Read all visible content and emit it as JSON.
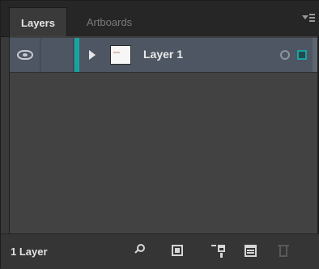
{
  "tabs": [
    {
      "label": "Layers",
      "active": true
    },
    {
      "label": "Artboards",
      "active": false
    }
  ],
  "layers": [
    {
      "name": "Layer 1",
      "visible": true,
      "expanded": false,
      "layer_color": "#17a3a0"
    }
  ],
  "footer": {
    "layer_count": "1 Layer",
    "buttons": [
      {
        "icon": "search-icon",
        "label": "Locate Object"
      },
      {
        "icon": "clipping-mask-icon",
        "label": "Make/Release Clipping Mask"
      },
      {
        "icon": "new-sublayer-icon",
        "label": "Create New Sublayer"
      },
      {
        "icon": "new-layer-icon",
        "label": "Create New Layer"
      },
      {
        "icon": "trash-icon",
        "label": "Delete Selection",
        "enabled": false
      }
    ]
  },
  "colors": {
    "panel_bg": "#3a3a3a",
    "row_selected": "#4e5663",
    "accent": "#17a3a0"
  }
}
